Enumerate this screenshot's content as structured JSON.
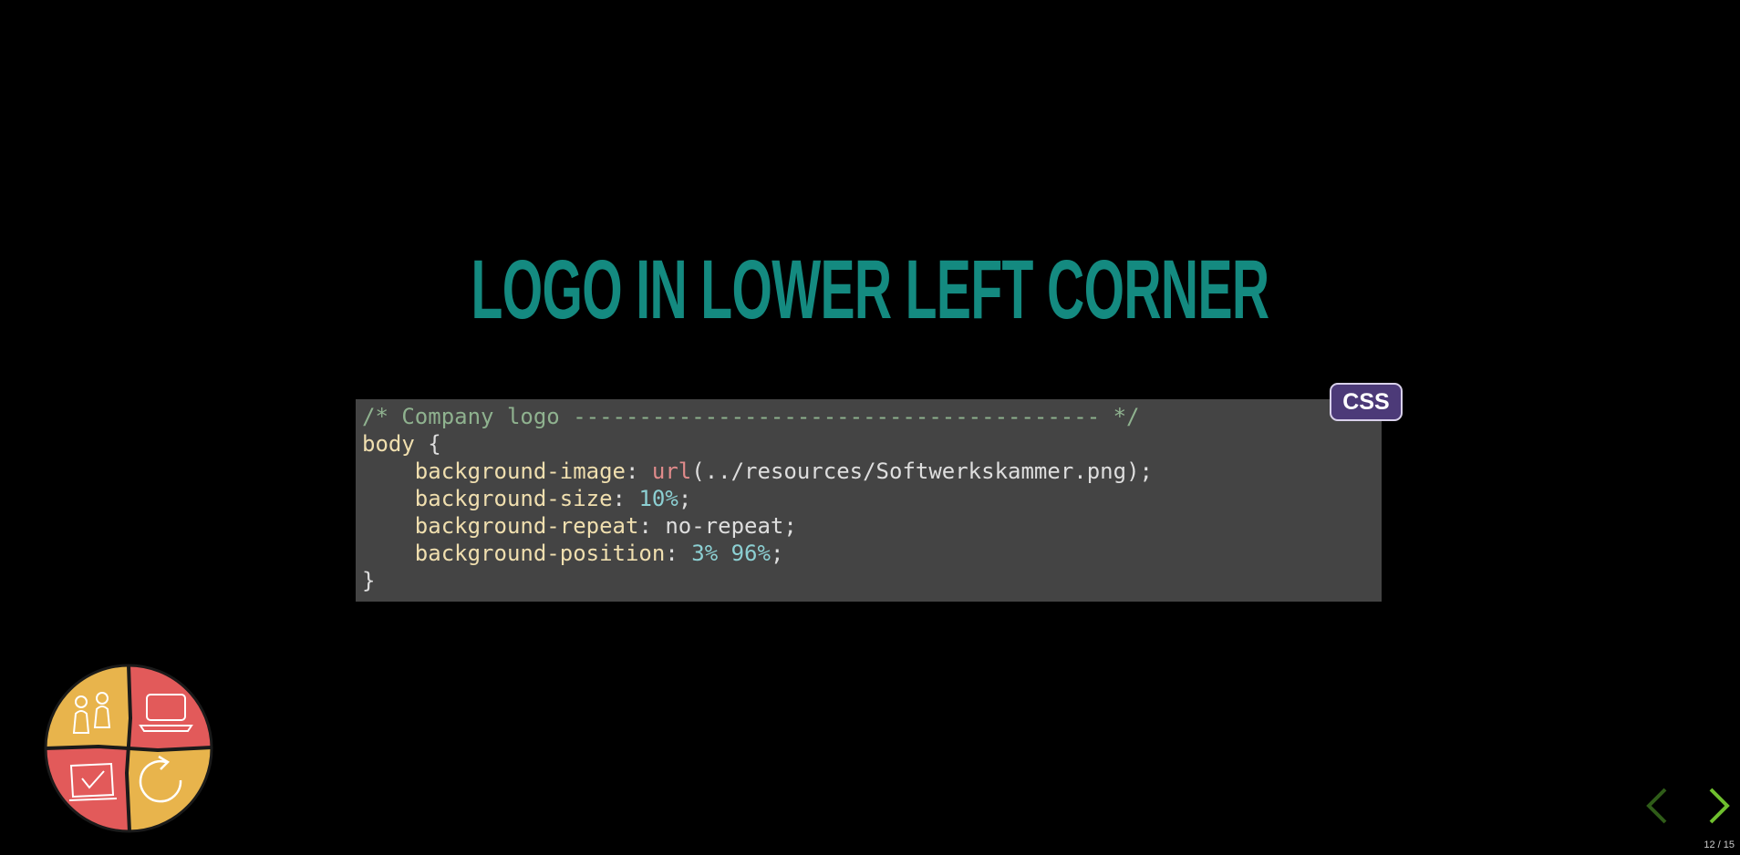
{
  "slide": {
    "title": "LOGO IN LOWER LEFT CORNER"
  },
  "code": {
    "language_badge": "CSS",
    "line1_comment": "/* Company logo ---------------------------------------- */",
    "line2_selector": "body",
    "line2_brace": " {",
    "line3_prop": "background-image",
    "line3_colon": ": ",
    "line3_url_fn": "url",
    "line3_rest": "(../resources/Softwerkskammer.png);",
    "line4_prop": "background-size",
    "line4_colon": ": ",
    "line4_val": "10%",
    "line4_end": ";",
    "line5_prop": "background-repeat",
    "line5_rest": ": no-repeat;",
    "line6_prop": "background-position",
    "line6_colon": ": ",
    "line6_val": "3% 96%",
    "line6_end": ";",
    "line7_close": "}"
  },
  "navigation": {
    "counter": "12 / 15",
    "prev_icon": "chevron-left-icon",
    "next_icon": "chevron-right-icon"
  },
  "logo": {
    "name": "softwerkskammer-logo",
    "colors": {
      "yellow": "#e8b44c",
      "red": "#e25a5a",
      "outline": "#1a1a1a"
    }
  },
  "colors": {
    "title": "#148a80",
    "code_background": "#444444",
    "badge_background": "#4c3a78",
    "nav_active": "#6fbf2e",
    "nav_inactive": "#2f5c18"
  }
}
